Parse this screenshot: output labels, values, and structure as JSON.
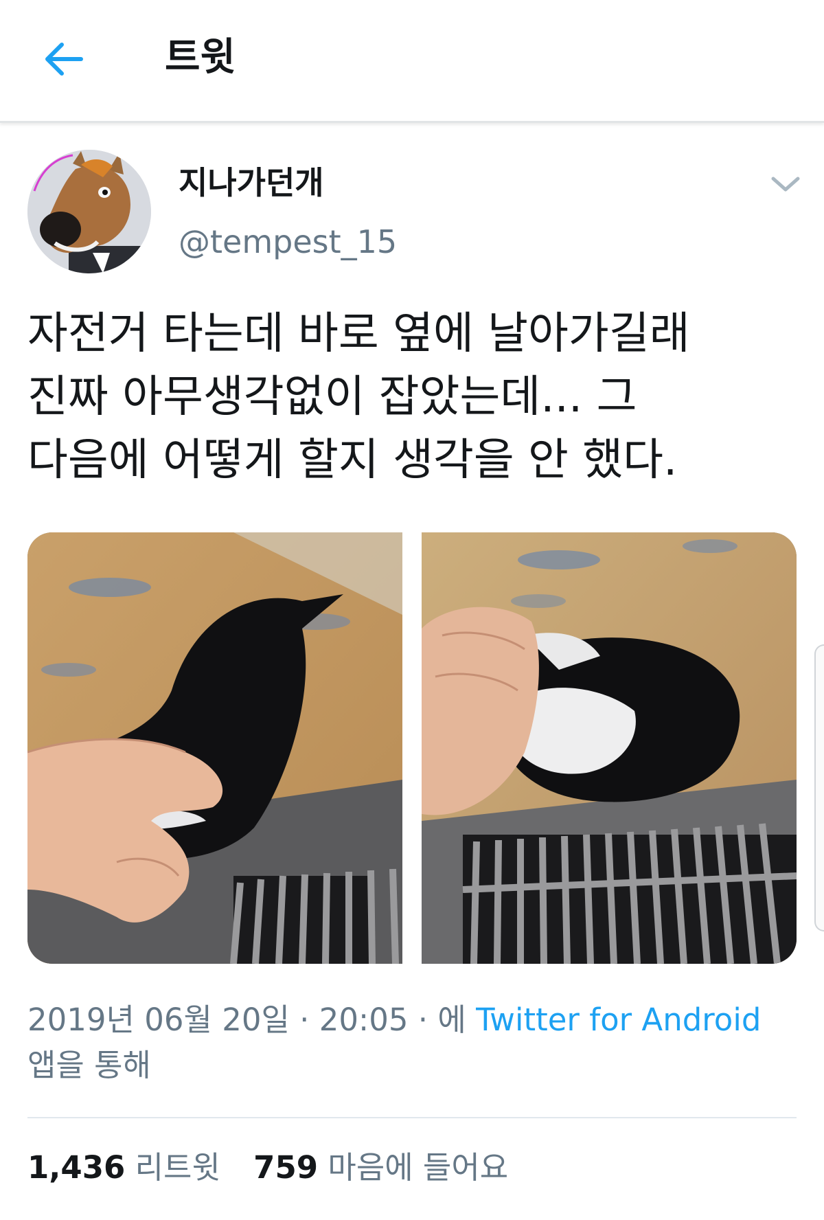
{
  "header": {
    "title": "트윗",
    "back_icon": "arrow-left-icon",
    "accent_color": "#1da1f2"
  },
  "author": {
    "display_name": "지나가던개",
    "handle": "@tempest_15",
    "avatar_icon": "horse-mask-avatar",
    "menu_icon": "chevron-down-icon"
  },
  "tweet": {
    "text_lines": [
      "자전거 타는데 바로 옆에 날아가길래",
      "진짜 아무생각없이 잡았는데... 그",
      "다음에 어떻게 할지 생각을 안 했다."
    ],
    "media": [
      {
        "name": "photo-magpie-held-in-hand"
      },
      {
        "name": "photo-magpie-held-upside-down"
      }
    ]
  },
  "meta": {
    "date": "2019년 06월 20일",
    "sep1": " · ",
    "time": "20:05",
    "sep2": " · ",
    "via_prefix": "에 ",
    "source": "Twitter for Android",
    "suffix": "앱을 통해"
  },
  "stats": {
    "retweets_count": "1,436",
    "retweets_label": "리트윗",
    "likes_count": "759",
    "likes_label": "마음에 들어요"
  }
}
